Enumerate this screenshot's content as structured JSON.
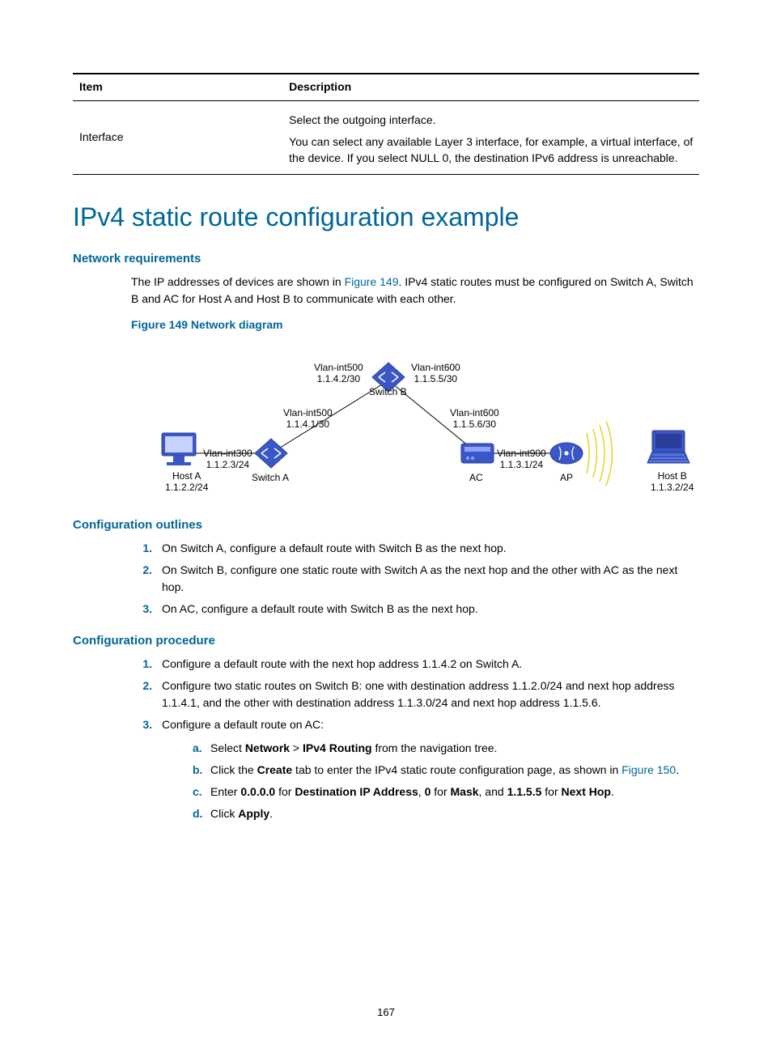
{
  "table": {
    "headers": [
      "Item",
      "Description"
    ],
    "row": {
      "item": "Interface",
      "desc1": "Select the outgoing interface.",
      "desc2": "You can select any available Layer 3 interface, for example, a virtual interface, of the device. If you select NULL 0, the destination IPv6 address is unreachable."
    }
  },
  "h1": "IPv4 static route configuration example",
  "h2_netreq": "Network requirements",
  "netreq_p1a": "The IP addresses of devices are shown in ",
  "netreq_fig_link": "Figure 149",
  "netreq_p1b": ". IPv4 static routes must be configured on Switch A, Switch B and AC for Host A and Host B to communicate with each other.",
  "figure_caption": "Figure 149 Network diagram",
  "diagram": {
    "switchB_top_left": "Vlan-int500\n1.1.4.2/30",
    "switchB_top_right": "Vlan-int600\n1.1.5.5/30",
    "switchB": "Switch B",
    "switchA_top": "Vlan-int500\n1.1.4.1/30",
    "switchA_left": "Vlan-int300\n1.1.2.3/24",
    "switchA": "Switch A",
    "hostA": "Host A\n1.1.2.2/24",
    "ac_top": "Vlan-int600\n1.1.5.6/30",
    "ac_right": "Vlan-int900\n1.1.3.1/24",
    "ac": "AC",
    "ap": "AP",
    "hostB": "Host B\n1.1.3.2/24"
  },
  "h2_outlines": "Configuration outlines",
  "outlines": [
    "On Switch A, configure a default route with Switch B as the next hop.",
    "On Switch B, configure one static route with Switch A as the next hop and the other with AC as the next hop.",
    "On AC, configure a default route with Switch B as the next hop."
  ],
  "h2_proc": "Configuration procedure",
  "proc": {
    "1": "Configure a default route with the next hop address 1.1.4.2 on Switch A.",
    "2": "Configure two static routes on Switch B: one with destination address 1.1.2.0/24 and next hop address 1.1.4.1, and the other with destination address 1.1.3.0/24 and next hop address 1.1.5.6.",
    "3": "Configure a default route on AC:",
    "sub": {
      "a_1": "Select ",
      "a_b1": "Network",
      "a_2": " > ",
      "a_b2": "IPv4 Routing",
      "a_3": " from the navigation tree.",
      "b_1": "Click the ",
      "b_b1": "Create",
      "b_2": " tab to enter the IPv4 static route configuration page, as shown in ",
      "b_link": "Figure 150",
      "b_3": ".",
      "c_1": "Enter ",
      "c_b1": "0.0.0.0",
      "c_2": " for ",
      "c_b2": "Destination IP Address",
      "c_3": ", ",
      "c_b3": "0",
      "c_4": " for ",
      "c_b4": "Mask",
      "c_5": ", and ",
      "c_b5": "1.1.5.5",
      "c_6": " for ",
      "c_b6": "Next Hop",
      "c_7": ".",
      "d_1": "Click ",
      "d_b1": "Apply",
      "d_2": "."
    }
  },
  "page_number": "167"
}
